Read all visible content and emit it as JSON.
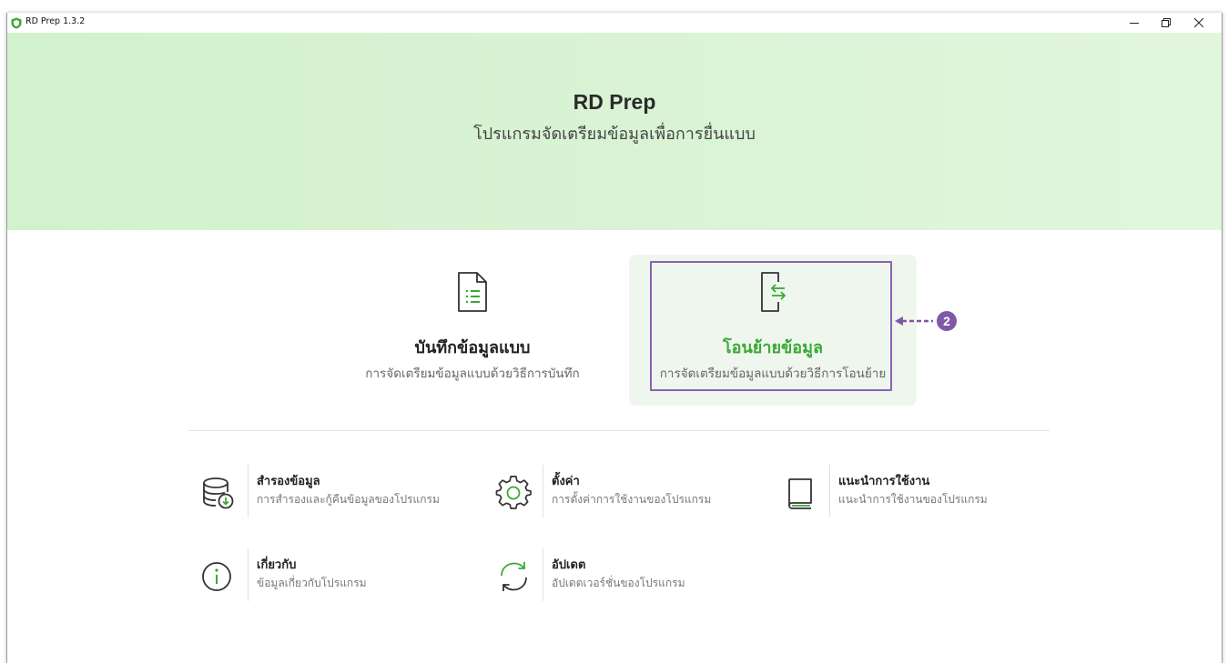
{
  "window": {
    "title": "RD Prep 1.3.2"
  },
  "banner": {
    "app_name": "RD Prep",
    "subtitle": "โปรแกรมจัดเตรียมข้อมูลเพื่อการยื่นแบบ"
  },
  "cards": [
    {
      "title": "บันทึกข้อมูลแบบ",
      "description": "การจัดเตรียมข้อมูลแบบด้วยวิธีการบันทึก",
      "icon": "document-list-icon"
    },
    {
      "title": "โอนย้ายข้อมูล",
      "description": "การจัดเตรียมข้อมูลแบบด้วยวิธีการโอนย้าย",
      "icon": "transfer-icon"
    }
  ],
  "callout": {
    "number": "2"
  },
  "features": [
    {
      "title": "สำรองข้อมูล",
      "description": "การสำรองและกู้คืนข้อมูลของโปรแกรม",
      "icon": "database-backup-icon"
    },
    {
      "title": "ตั้งค่า",
      "description": "การตั้งค่าการใช้งานของโปรแกรม",
      "icon": "gear-icon"
    },
    {
      "title": "แนะนำการใช้งาน",
      "description": "แนะนำการใช้งานของโปรแกรม",
      "icon": "book-icon"
    },
    {
      "title": "เกี่ยวกับ",
      "description": "ข้อมูลเกี่ยวกับโปรแกรม",
      "icon": "info-icon"
    },
    {
      "title": "อัปเดต",
      "description": "อัปเดตเวอร์ชั่นของโปรแกรม",
      "icon": "refresh-icon"
    }
  ],
  "colors": {
    "accent_green": "#3aa935",
    "banner_green": "#d2f1cd",
    "callout_purple": "#8a63b0"
  }
}
